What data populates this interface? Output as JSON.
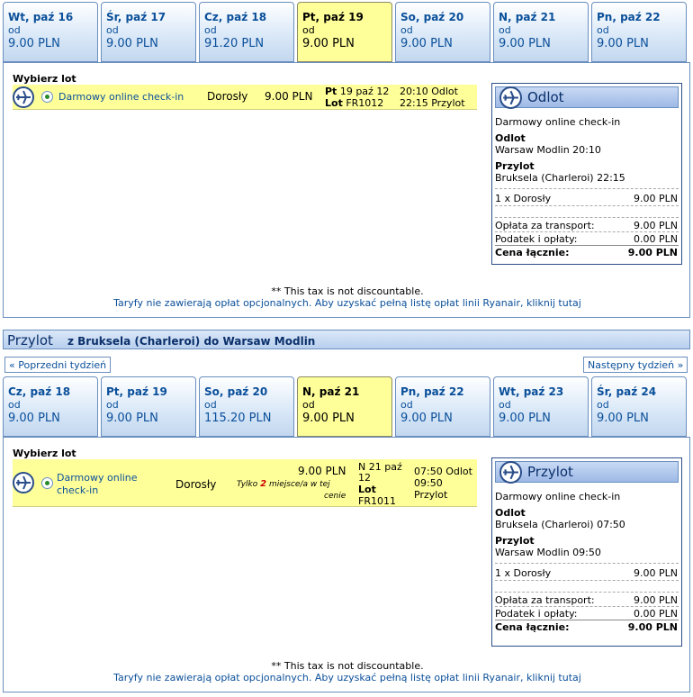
{
  "outbound_tabs": [
    {
      "day": "Wt, paź 16",
      "from": "od",
      "price": "9.00 PLN"
    },
    {
      "day": "Śr, paź 17",
      "from": "od",
      "price": "9.00 PLN"
    },
    {
      "day": "Cz, paź 18",
      "from": "od",
      "price": "91.20 PLN"
    },
    {
      "day": "Pt, paź 19",
      "from": "od",
      "price": "9.00 PLN"
    },
    {
      "day": "So, paź 20",
      "from": "od",
      "price": "9.00 PLN"
    },
    {
      "day": "N, paź 21",
      "from": "od",
      "price": "9.00 PLN"
    },
    {
      "day": "Pn, paź 22",
      "from": "od",
      "price": "9.00 PLN"
    }
  ],
  "outbound": {
    "select_label": "Wybierz lot",
    "fare_name": "Darmowy online check-in",
    "passenger": "Dorosły",
    "price": "9.00 PLN",
    "date_day": "Pt",
    "date_rest": "19 paź 12",
    "flight_label": "Lot",
    "flight_no": "FR1012",
    "dep_time": "20:10 Odlot",
    "arr_time": "22:15 Przylot",
    "summary": {
      "title": "Odlot",
      "fare": "Darmowy online check-in",
      "dep_label": "Odlot",
      "dep_value": "Warsaw Modlin 20:10",
      "arr_label": "Przylot",
      "arr_value": "Bruksela (Charleroi) 22:15",
      "pax_label": "1 x Dorosły",
      "pax_value": "9.00 PLN",
      "transport_label": "Opłata za transport:",
      "transport_value": "9.00 PLN",
      "tax_label": "Podatek i opłaty:",
      "tax_value": "0.00 PLN",
      "total_label": "Cena łącznie:",
      "total_value": "9.00 PLN"
    },
    "tax_note": "** This tax is not discountable.",
    "fees_link": "Taryfy nie zawierają opłat opcjonalnych. Aby uzyskać pełną listę opłat linii Ryanair, kliknij tutaj"
  },
  "return_bar": {
    "title": "Przylot",
    "route": "z Bruksela (Charleroi) do Warsaw Modlin",
    "prev_week": "« Poprzedni tydzień",
    "next_week": "Następny tydzień »"
  },
  "return_tabs": [
    {
      "day": "Cz, paź 18",
      "from": "od",
      "price": "9.00 PLN"
    },
    {
      "day": "Pt, paź 19",
      "from": "od",
      "price": "9.00 PLN"
    },
    {
      "day": "So, paź 20",
      "from": "od",
      "price": "115.20 PLN"
    },
    {
      "day": "N, paź 21",
      "from": "od",
      "price": "9.00 PLN"
    },
    {
      "day": "Pn, paź 22",
      "from": "od",
      "price": "9.00 PLN"
    },
    {
      "day": "Wt, paź 23",
      "from": "od",
      "price": "9.00 PLN"
    },
    {
      "day": "Śr, paź 24",
      "from": "od",
      "price": "9.00 PLN"
    }
  ],
  "return": {
    "select_label": "Wybierz lot",
    "fare_name_1": "Darmowy online",
    "fare_name_2": "check-in",
    "passenger": "Dorosły",
    "price": "9.00 PLN",
    "seats_1": "Tylko",
    "seats_num": "2",
    "seats_2": "miejsce/a w tej",
    "seats_3": "cenie",
    "date_line1": "N 21 paź",
    "date_line2": "12",
    "flight_label": "Lot",
    "flight_no": "FR1011",
    "dep_time": "07:50 Odlot",
    "arr_time_1": "09:50",
    "arr_time_2": "Przylot",
    "summary": {
      "title": "Przylot",
      "fare": "Darmowy online check-in",
      "dep_label": "Odlot",
      "dep_value": "Bruksela (Charleroi) 07:50",
      "arr_label": "Przylot",
      "arr_value": "Warsaw Modlin 09:50",
      "pax_label": "1 x Dorosły",
      "pax_value": "9.00 PLN",
      "transport_label": "Opłata za transport:",
      "transport_value": "9.00 PLN",
      "tax_label": "Podatek i opłaty:",
      "tax_value": "0.00 PLN",
      "total_label": "Cena łącznie:",
      "total_value": "9.00 PLN"
    },
    "tax_note": "** This tax is not discountable.",
    "fees_link": "Taryfy nie zawierają opłat opcjonalnych. Aby uzyskać pełną listę opłat linii Ryanair, kliknij tutaj"
  },
  "colors": {
    "accent": "#0a4f9a",
    "selected_tab": "#ffff99",
    "border": "#6a8fbf"
  }
}
